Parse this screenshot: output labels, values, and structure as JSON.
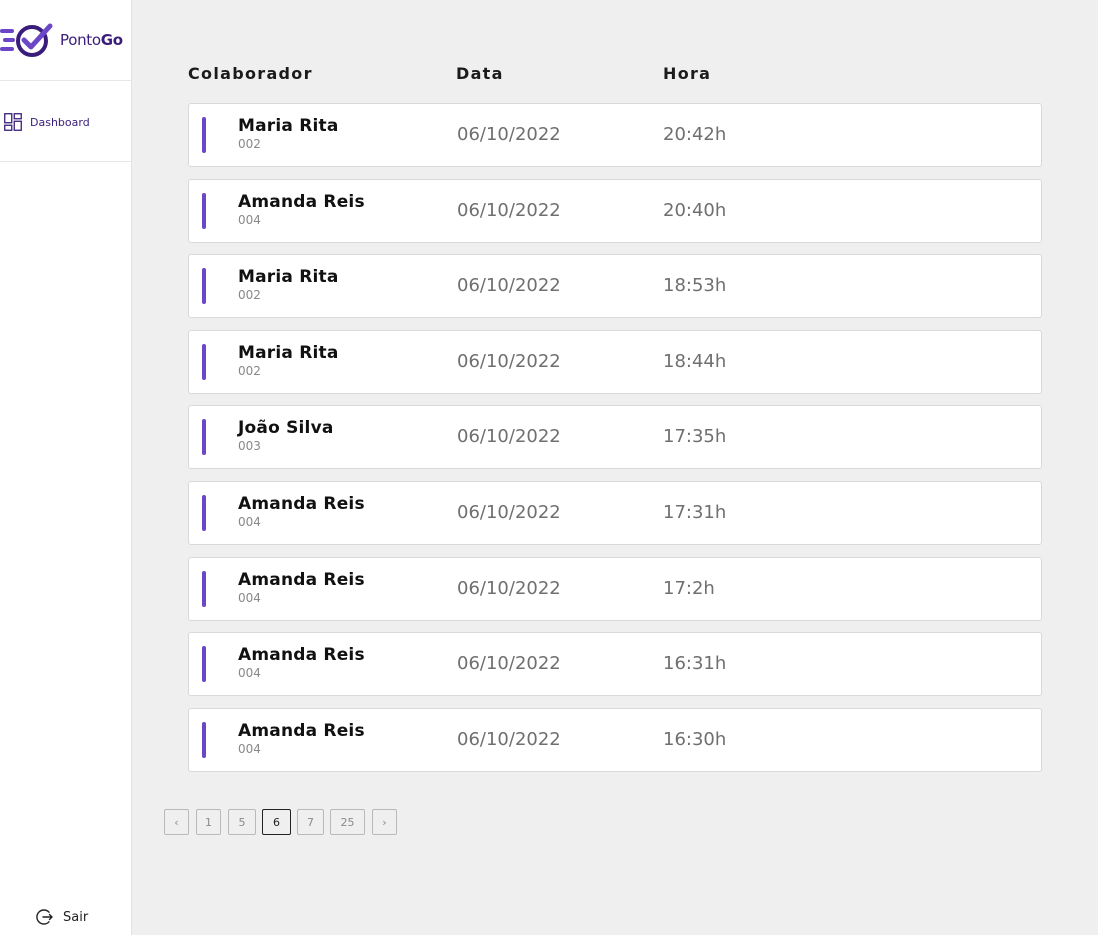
{
  "brand": {
    "name_plain": "Ponto",
    "name_bold": "Go",
    "accent": "#6b47c7",
    "brand_color": "#3a1d7a"
  },
  "sidebar": {
    "nav": [
      {
        "label": "Dashboard",
        "icon": "dashboard-grid-icon"
      }
    ],
    "logout_label": "Sair"
  },
  "table": {
    "headers": {
      "colaborador": "Colaborador",
      "data": "Data",
      "hora": "Hora"
    },
    "rows": [
      {
        "name": "Maria Rita",
        "code": "002",
        "date": "06/10/2022",
        "time": "20:42h"
      },
      {
        "name": "Amanda Reis",
        "code": "004",
        "date": "06/10/2022",
        "time": "20:40h"
      },
      {
        "name": "Maria Rita",
        "code": "002",
        "date": "06/10/2022",
        "time": "18:53h"
      },
      {
        "name": "Maria Rita",
        "code": "002",
        "date": "06/10/2022",
        "time": "18:44h"
      },
      {
        "name": "João Silva",
        "code": "003",
        "date": "06/10/2022",
        "time": "17:35h"
      },
      {
        "name": "Amanda Reis",
        "code": "004",
        "date": "06/10/2022",
        "time": "17:31h"
      },
      {
        "name": "Amanda Reis",
        "code": "004",
        "date": "06/10/2022",
        "time": "17:2h"
      },
      {
        "name": "Amanda Reis",
        "code": "004",
        "date": "06/10/2022",
        "time": "16:31h"
      },
      {
        "name": "Amanda Reis",
        "code": "004",
        "date": "06/10/2022",
        "time": "16:30h"
      }
    ]
  },
  "pagination": {
    "prev_label": "‹",
    "next_label": "›",
    "pages": [
      "1",
      "5",
      "6",
      "7",
      "25"
    ],
    "current": "6"
  }
}
